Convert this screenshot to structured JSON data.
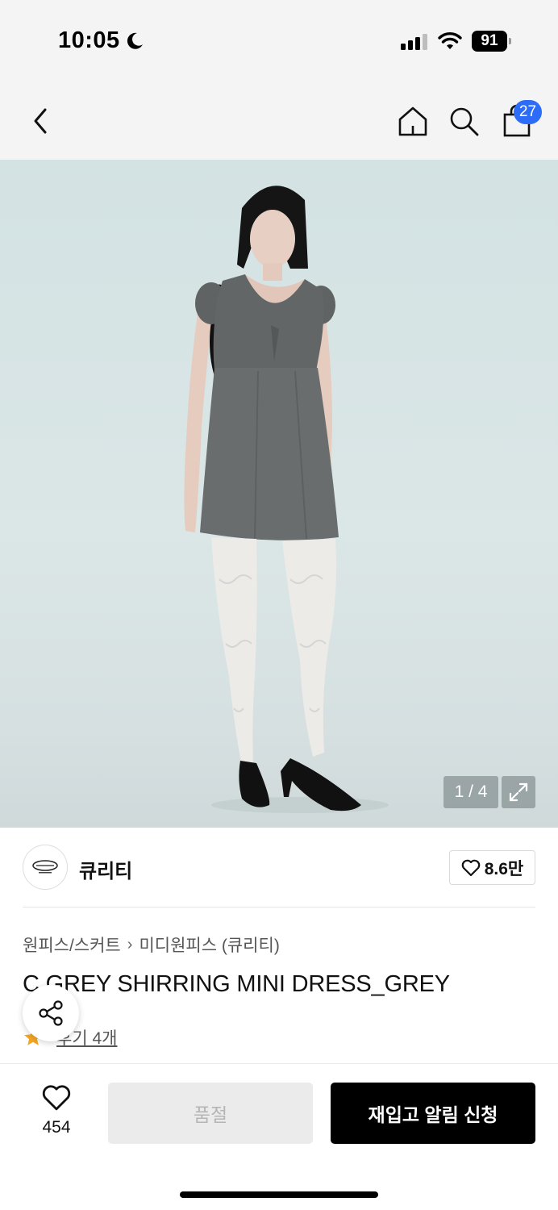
{
  "status_bar": {
    "time": "10:05",
    "battery": "91"
  },
  "nav": {
    "cart_count": "27"
  },
  "gallery": {
    "counter": "1 / 4"
  },
  "brand": {
    "name": "큐리티",
    "likes": "8.6만"
  },
  "product": {
    "breadcrumb": [
      "원피스/스커트",
      "미디원피스 (큐리티)"
    ],
    "title": "C GREY SHIRRING MINI DRESS_GREY",
    "review_label": "후기 4개",
    "rating_star_color": "#f5a623"
  },
  "bottom": {
    "wish_count": "454",
    "soldout_label": "품절",
    "restock_label": "재입고 알림 신청"
  },
  "colors": {
    "accent_blue": "#2d6cf6",
    "primary_button": "#000000",
    "disabled_button": "#ebebeb"
  }
}
